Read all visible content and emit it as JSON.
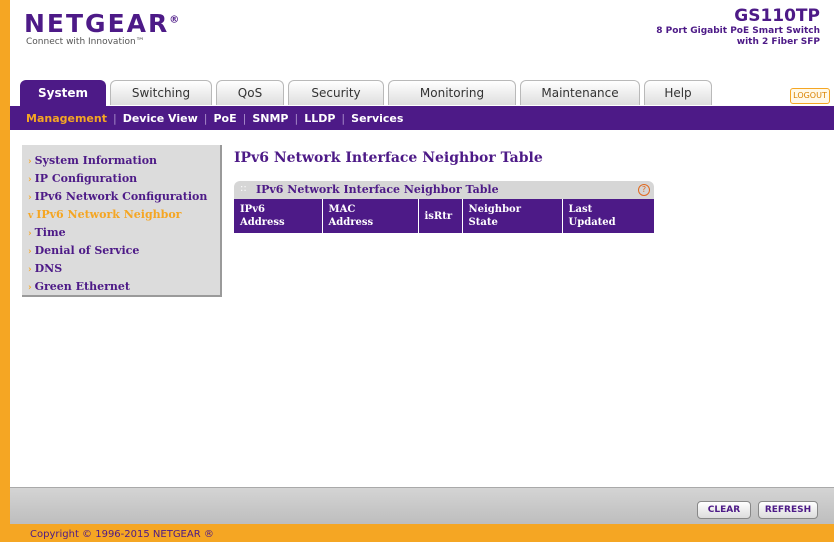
{
  "header": {
    "logo": "NETGEAR",
    "tagline": "Connect with Innovation™",
    "model": "GS110TP",
    "model_desc_line1": "8 Port Gigabit PoE Smart Switch",
    "model_desc_line2": "with 2 Fiber SFP",
    "logout_label": "LOGOUT"
  },
  "tabs": [
    {
      "label": "System",
      "active": true
    },
    {
      "label": "Switching"
    },
    {
      "label": "QoS"
    },
    {
      "label": "Security"
    },
    {
      "label": "Monitoring"
    },
    {
      "label": "Maintenance"
    },
    {
      "label": "Help"
    }
  ],
  "subnav": [
    "Management",
    "Device View",
    "PoE",
    "SNMP",
    "LLDP",
    "Services"
  ],
  "sidebar": {
    "items": [
      "System Information",
      "IP Configuration",
      "IPv6 Network Configuration",
      "IPv6 Network Neighbor",
      "Time",
      "Denial of Service",
      "DNS",
      "Green Ethernet"
    ]
  },
  "main": {
    "title": "IPv6 Network Interface Neighbor Table",
    "panel_title": "IPv6 Network Interface Neighbor Table",
    "help_icon": "?",
    "columns": [
      {
        "line1": "IPv6",
        "line2": "Address"
      },
      {
        "line1": "MAC",
        "line2": "Address"
      },
      {
        "line1": "isRtr",
        "line2": ""
      },
      {
        "line1": "Neighbor",
        "line2": "State"
      },
      {
        "line1": "Last",
        "line2": "Updated"
      }
    ]
  },
  "buttons": {
    "clear": "CLEAR",
    "refresh": "REFRESH"
  },
  "footer": {
    "copyright": "Copyright © 1996-2015 NETGEAR ®"
  },
  "colors": {
    "brand_purple": "#4d1a87",
    "accent_orange": "#f5a623"
  }
}
